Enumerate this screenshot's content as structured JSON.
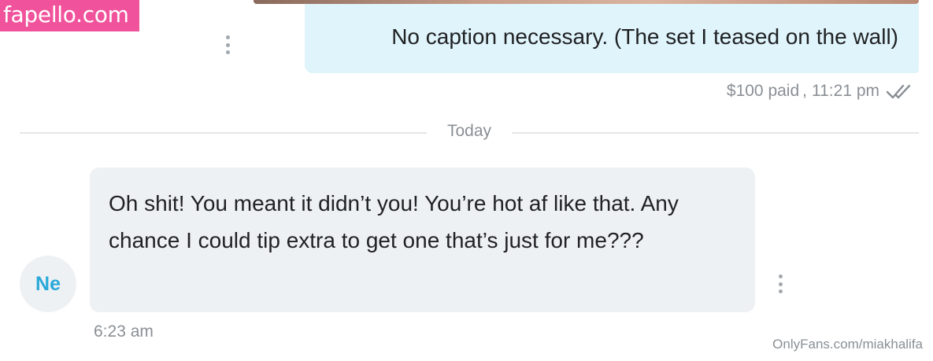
{
  "watermark": {
    "top_text": "fapello.com",
    "top_color": "#f0539c",
    "bottom_text": "OnlyFans.com/miakhalifa"
  },
  "outgoing_message": {
    "text": "No caption necessary. (The set I teased on the wall)",
    "price": "$100 paid",
    "separator": ",",
    "time": "11:21 pm",
    "status_icon": "double-check-icon",
    "bubble_color": "#e0f4fb"
  },
  "date_divider": {
    "label": "Today"
  },
  "incoming_message": {
    "avatar_initials": "Ne",
    "text": "Oh shit! You meant it didn’t you! You’re hot af like that. Any chance I could tip extra to get one that’s just for me???",
    "time": "6:23 am",
    "bubble_color": "#eef1f3",
    "accent_color": "#2aa8d8"
  },
  "icons": {
    "message_options": "more-vertical-icon"
  }
}
